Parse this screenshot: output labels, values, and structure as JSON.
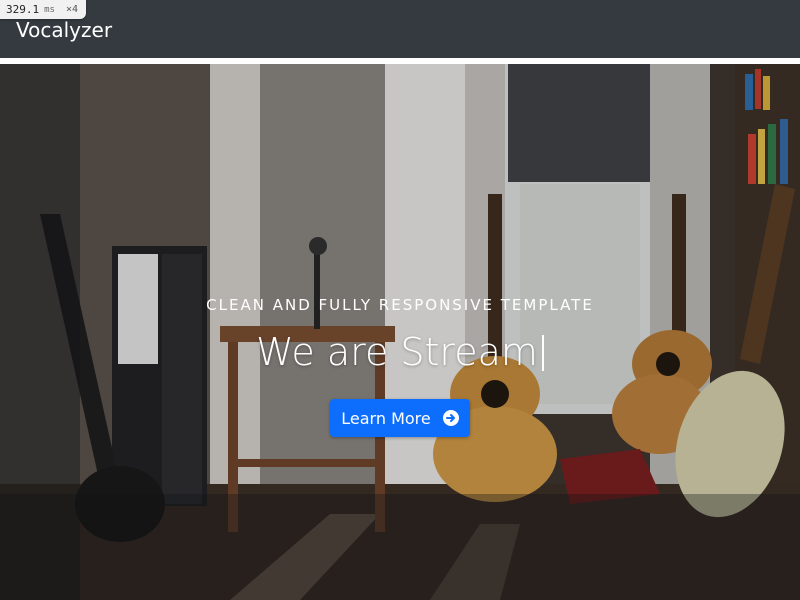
{
  "perf": {
    "value": "329.1",
    "unit": "ms",
    "multiplier": "×4"
  },
  "navbar": {
    "brand": "Vocalyzer"
  },
  "hero": {
    "subtitle": "CLEAN AND FULLY RESPONSIVE TEMPLATE",
    "headline": "We are Stream",
    "cta_label": "Learn More"
  },
  "colors": {
    "navbar": "#343a40",
    "accent": "#0d6efd",
    "text": "#ffffff"
  },
  "icons": {
    "cta": "arrow-circle-right-icon"
  }
}
